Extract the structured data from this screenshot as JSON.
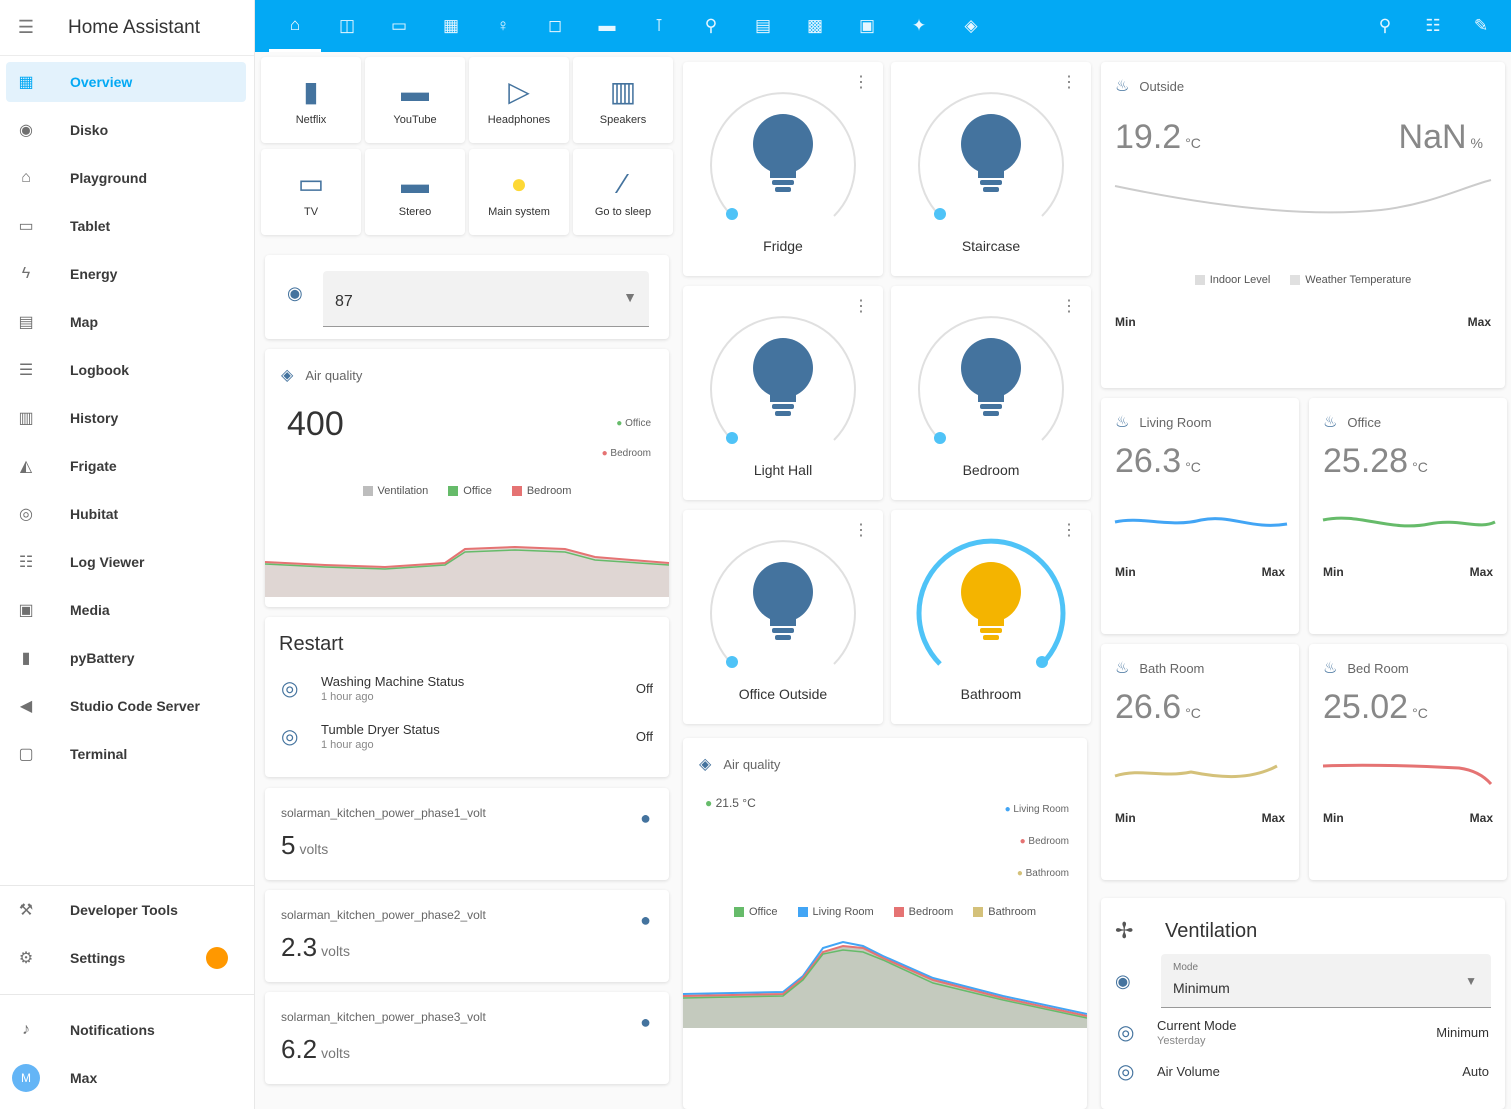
{
  "app": {
    "title": "Home Assistant"
  },
  "sidebar": {
    "items": [
      {
        "label": "Overview",
        "icon": "view-dashboard-icon",
        "glyph": "▦",
        "active": true
      },
      {
        "label": "Disko",
        "icon": "disc-icon",
        "glyph": "◉"
      },
      {
        "label": "Playground",
        "icon": "playground-icon",
        "glyph": "⌂"
      },
      {
        "label": "Tablet",
        "icon": "tablet-icon",
        "glyph": "▭"
      },
      {
        "label": "Energy",
        "icon": "lightning-icon",
        "glyph": "ϟ"
      },
      {
        "label": "Map",
        "icon": "map-icon",
        "glyph": "▤"
      },
      {
        "label": "Logbook",
        "icon": "logbook-icon",
        "glyph": "☰"
      },
      {
        "label": "History",
        "icon": "history-icon",
        "glyph": "▥"
      },
      {
        "label": "Frigate",
        "icon": "cctv-icon",
        "glyph": "◭"
      },
      {
        "label": "Hubitat",
        "icon": "hubitat-icon",
        "glyph": "◎"
      },
      {
        "label": "Log Viewer",
        "icon": "log-viewer-icon",
        "glyph": "☷"
      },
      {
        "label": "Media",
        "icon": "media-icon",
        "glyph": "▣"
      },
      {
        "label": "pyBattery",
        "icon": "battery-icon",
        "glyph": "▮"
      },
      {
        "label": "Studio Code Server",
        "icon": "code-icon",
        "glyph": "◀"
      },
      {
        "label": "Terminal",
        "icon": "terminal-icon",
        "glyph": "▢"
      }
    ],
    "developer_tools": "Developer Tools",
    "settings": "Settings",
    "notifications": "Notifications",
    "user": "Max",
    "user_initial": "M"
  },
  "topbar": {
    "tabs": [
      {
        "icon": "home-icon",
        "glyph": "⌂"
      },
      {
        "icon": "sofa-icon",
        "glyph": "◫"
      },
      {
        "icon": "bed-icon",
        "glyph": "▭"
      },
      {
        "icon": "kitchen-icon",
        "glyph": "▦"
      },
      {
        "icon": "lightbulb-icon",
        "glyph": "♀"
      },
      {
        "icon": "window-icon",
        "glyph": "◻"
      },
      {
        "icon": "garage-icon",
        "glyph": "▬"
      },
      {
        "icon": "thermometer-icon",
        "glyph": "⊺"
      },
      {
        "icon": "robot-icon",
        "glyph": "⚲"
      },
      {
        "icon": "server-icon",
        "glyph": "▤"
      },
      {
        "icon": "router-icon",
        "glyph": "▩"
      },
      {
        "icon": "tv-icon",
        "glyph": "▣"
      },
      {
        "icon": "plug-icon",
        "glyph": "✦"
      },
      {
        "icon": "shield-icon",
        "glyph": "◈"
      }
    ],
    "actions": [
      {
        "icon": "search-icon",
        "glyph": "⚲"
      },
      {
        "icon": "assist-icon",
        "glyph": "☷"
      },
      {
        "icon": "edit-icon",
        "glyph": "✎"
      }
    ]
  },
  "buttons": [
    {
      "label": "Netflix",
      "icon": "netflix-icon",
      "glyph": "▮"
    },
    {
      "label": "YouTube",
      "icon": "youtube-icon",
      "glyph": "▬"
    },
    {
      "label": "Headphones",
      "icon": "headphones-icon",
      "glyph": "▷"
    },
    {
      "label": "Speakers",
      "icon": "speaker-icon",
      "glyph": "▥"
    },
    {
      "label": "TV",
      "icon": "monitor-icon",
      "glyph": "▭"
    },
    {
      "label": "Stereo",
      "icon": "stereo-icon",
      "glyph": "▬"
    },
    {
      "label": "Main system",
      "icon": "bulb-on-icon",
      "glyph": "●",
      "on": true
    },
    {
      "label": "Go to sleep",
      "icon": "sleep-icon",
      "glyph": "⁄"
    }
  ],
  "select": {
    "value": "87"
  },
  "co2_graph": {
    "title": "Air quality",
    "value": "400",
    "mini": [
      "Office",
      "Bedroom"
    ],
    "legend": [
      "Ventilation",
      "Office",
      "Bedroom"
    ]
  },
  "restart": {
    "title": "Restart",
    "rows": [
      {
        "name": "Washing Machine Status",
        "secondary": "1 hour ago",
        "state": "Off"
      },
      {
        "name": "Tumble Dryer Status",
        "secondary": "1 hour ago",
        "state": "Off"
      }
    ]
  },
  "power_sensors": [
    {
      "name": "solarman_kitchen_power_phase1_volt",
      "value": "5",
      "unit": "volts"
    },
    {
      "name": "solarman_kitchen_power_phase2_volt",
      "value": "2.3",
      "unit": "volts"
    },
    {
      "name": "solarman_kitchen_power_phase3_volt",
      "value": "6.2",
      "unit": "volts"
    }
  ],
  "lights": [
    {
      "name": "Fridge",
      "on": false
    },
    {
      "name": "Staircase",
      "on": false
    },
    {
      "name": "Light Hall",
      "on": false
    },
    {
      "name": "Bedroom",
      "on": false
    },
    {
      "name": "Office Outside",
      "on": false
    },
    {
      "name": "Bathroom",
      "on": true
    }
  ],
  "temp_graph": {
    "title": "Air quality",
    "first_value": "21.5",
    "first_unit": "°C",
    "mini": [
      "Office",
      "Living Room",
      "Bedroom",
      "Bathroom"
    ],
    "legend": [
      "Office",
      "Living Room",
      "Bedroom",
      "Bathroom"
    ]
  },
  "outside": {
    "title": "Outside",
    "value": "19.2",
    "unit": "°C",
    "right_value": "NaN",
    "right_unit": "%",
    "legend": [
      "Indoor Level",
      "Weather Temperature"
    ],
    "min_label": "Min",
    "max_label": "Max"
  },
  "rooms": [
    {
      "name": "Living Room",
      "value": "26.3",
      "unit": "°C",
      "color": "#42a5f5"
    },
    {
      "name": "Office",
      "value": "25.28",
      "unit": "°C",
      "color": "#66bb6a"
    },
    {
      "name": "Bath Room",
      "value": "26.6",
      "unit": "°C",
      "color": "#d4c17a"
    },
    {
      "name": "Bed Room",
      "value": "25.02",
      "unit": "°C",
      "color": "#e57373"
    }
  ],
  "minmax": {
    "min_label": "Min",
    "max_label": "Max"
  },
  "ventilation": {
    "title": "Ventilation",
    "select_label": "Mode",
    "select_value": "Minimum",
    "rows": [
      {
        "name": "Current Mode",
        "secondary": "Yesterday",
        "state": "Minimum"
      },
      {
        "name": "Air Volume",
        "state": "Auto"
      }
    ]
  }
}
